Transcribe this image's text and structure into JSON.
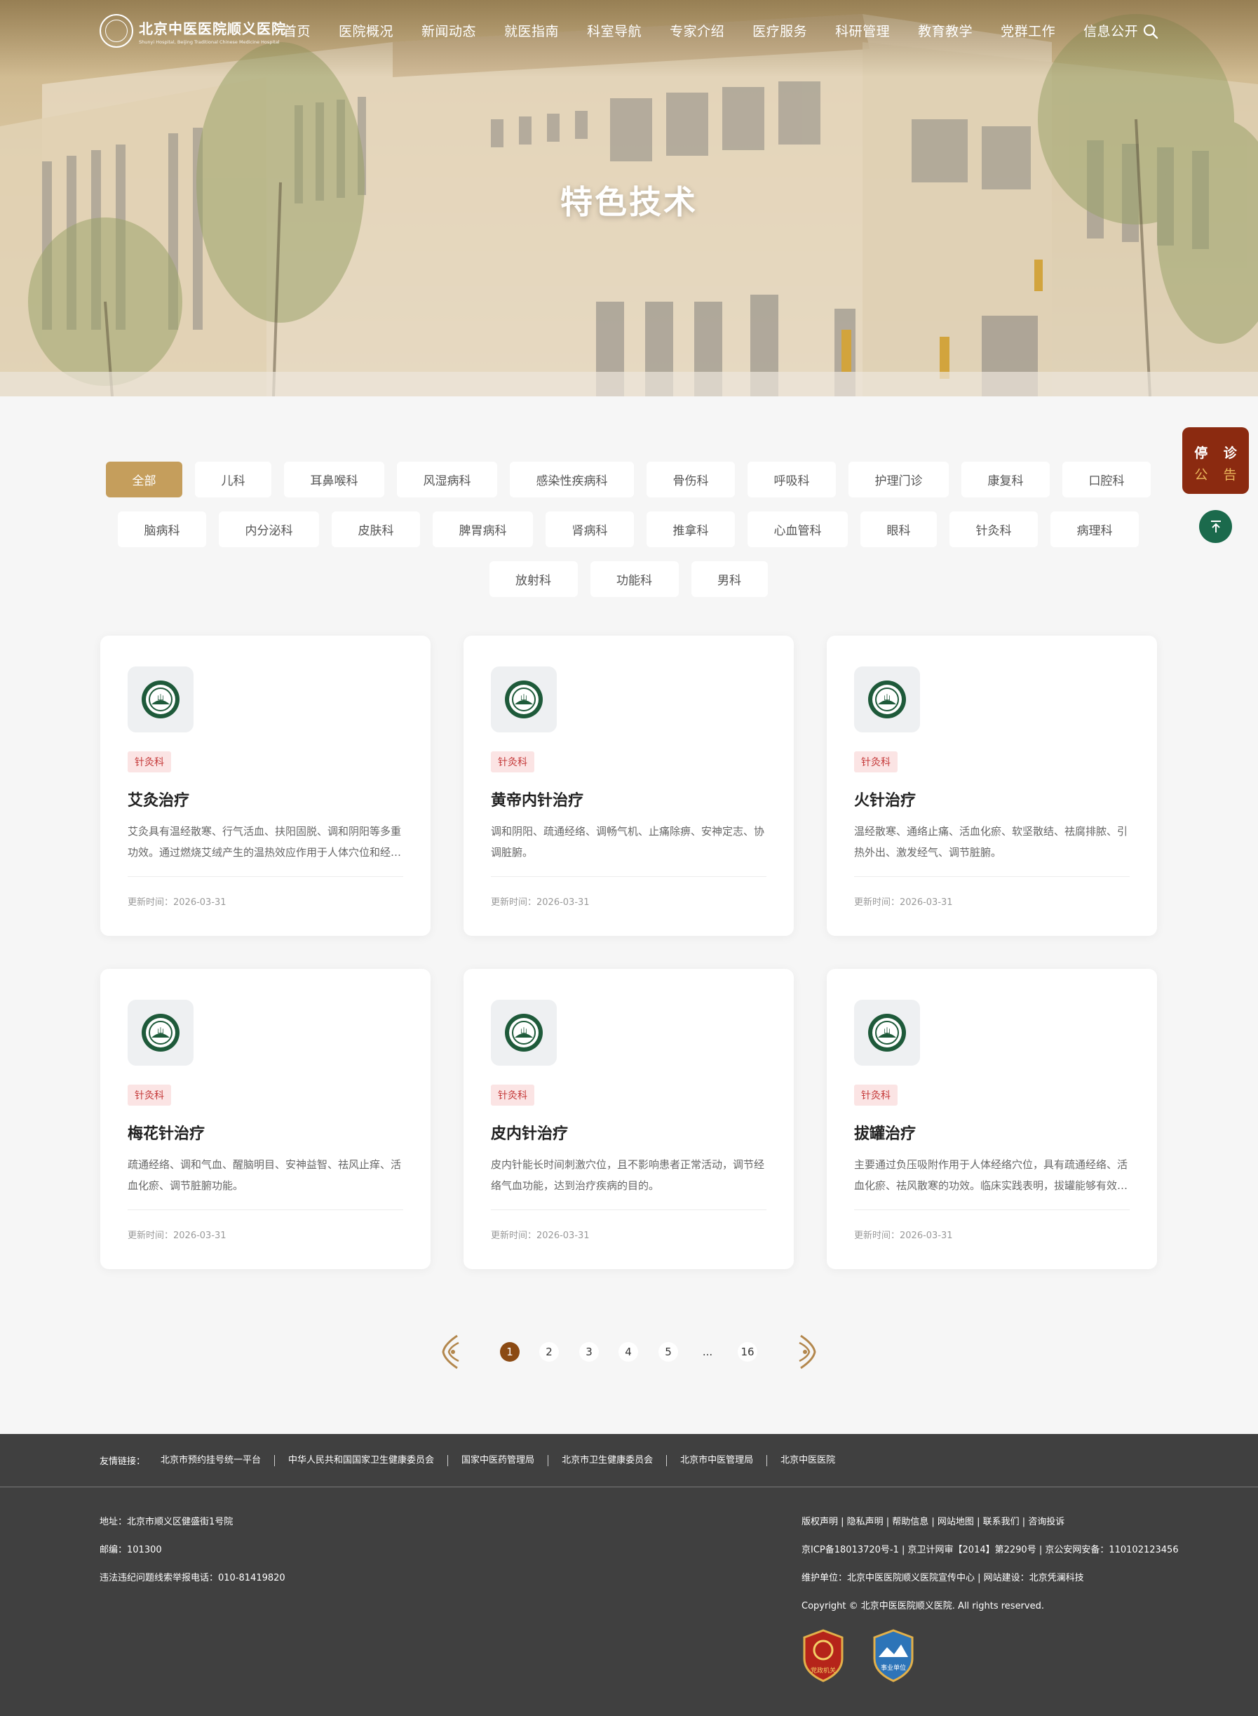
{
  "header": {
    "logo_cn": "北京中医医院顺义医院",
    "logo_en": "Shunyi Hospital, Beijing Traditional Chinese Medicine Hospital",
    "nav": [
      "首页",
      "医院概况",
      "新闻动态",
      "就医指南",
      "科室导航",
      "专家介绍",
      "医疗服务",
      "科研管理",
      "教育教学",
      "党群工作",
      "信息公开"
    ],
    "search_icon": "search-icon"
  },
  "hero": {
    "title": "特色技术"
  },
  "float": {
    "notice_line1": "停 诊",
    "notice_line2": "公 告",
    "totop_icon": "arrow-up-icon"
  },
  "filters": [
    [
      "全部",
      "儿科",
      "耳鼻喉科",
      "风湿病科",
      "感染性疾病科",
      "骨伤科",
      "呼吸科",
      "护理门诊",
      "康复科",
      "口腔科"
    ],
    [
      "脑病科",
      "内分泌科",
      "皮肤科",
      "脾胃病科",
      "肾病科",
      "推拿科",
      "心血管科",
      "眼科",
      "针灸科",
      "病理科"
    ],
    [
      "放射科",
      "功能科",
      "男科"
    ]
  ],
  "active_filter": "全部",
  "cards": [
    {
      "tag": "针灸科",
      "title": "艾灸治疗",
      "desc": "艾灸具有温经散寒、行气活血、扶阳固脱、调和阴阳等多重功效。通过燃烧艾绒产生的温热效应作用于人体穴位和经络，达到防病治病的目的。",
      "date": "更新时间：2026-03-31"
    },
    {
      "tag": "针灸科",
      "title": "黄帝内针治疗",
      "desc": "调和阴阳、疏通经络、调畅气机、止痛除痹、安神定志、协调脏腑。",
      "date": "更新时间：2026-03-31"
    },
    {
      "tag": "针灸科",
      "title": "火针治疗",
      "desc": "温经散寒、通络止痛、活血化瘀、软坚散结、祛腐排脓、引热外出、激发经气、调节脏腑。",
      "date": "更新时间：2026-03-31"
    },
    {
      "tag": "针灸科",
      "title": "梅花针治疗",
      "desc": "疏通经络、调和气血、醒脑明目、安神益智、祛风止痒、活血化瘀、调节脏腑功能。",
      "date": "更新时间：2026-03-31"
    },
    {
      "tag": "针灸科",
      "title": "皮内针治疗",
      "desc": "皮内针能长时间刺激穴位，且不影响患者正常活动，调节经络气血功能，达到治疗疾病的目的。",
      "date": "更新时间：2026-03-31"
    },
    {
      "tag": "针灸科",
      "title": "拔罐治疗",
      "desc": "主要通过负压吸附作用于人体经络穴位，具有疏通经络、活血化瘀、祛风散寒的功效。临床实践表明，拔罐能够有效缓解多种病症。",
      "date": "更新时间：2026-03-31"
    }
  ],
  "pagination": {
    "pages": [
      "1",
      "2",
      "3",
      "4",
      "5",
      "...",
      "16"
    ],
    "current": "1",
    "prev_icon": "ornate-left-arrow-icon",
    "next_icon": "ornate-right-arrow-icon"
  },
  "footer": {
    "links_label": "友情链接：",
    "links": [
      "北京市预约挂号统一平台",
      "中华人民共和国国家卫生健康委员会",
      "国家中医药管理局",
      "北京市卫生健康委员会",
      "北京市中医管理局",
      "北京中医医院"
    ],
    "address": "地址：北京市顺义区健盛街1号院",
    "postcode": "邮编：101300",
    "hotline": "违法违纪问题线索举报电话：010-81419820",
    "policy": "版权声明 | 隐私声明 | 帮助信息 | 网站地图 | 联系我们 | 咨询投诉",
    "icp": "京ICP备18013720号-1 | 京卫计网审【2014】第2290号 | 京公安网安备：110102123456",
    "maintain": "维护单位：北京中医医院顺义医院宣传中心 | 网站建设：北京凭澜科技",
    "copyright": "Copyright © 北京中医医院顺义医院. All rights reserved.",
    "emblem1_text": "党政机关",
    "emblem2_text": "事业单位"
  },
  "colors": {
    "accent_gold": "#c59e5c",
    "brown": "#8b4a13",
    "notice_red": "#8b2a10",
    "green": "#1b6a4c",
    "footer_bg": "#404040"
  }
}
